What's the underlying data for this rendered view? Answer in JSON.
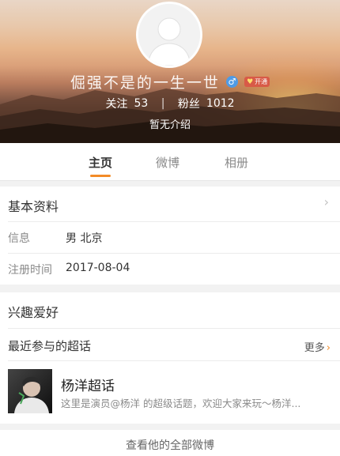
{
  "profile": {
    "username": "倔强不是的一生一世",
    "gender_icon": "male-icon",
    "vip_label": "开通",
    "follow_label": "关注",
    "follow_count": "53",
    "fans_label": "粉丝",
    "fans_count": "1012",
    "bio": "暂无介绍"
  },
  "tabs": [
    {
      "label": "主页",
      "active": true
    },
    {
      "label": "微博",
      "active": false
    },
    {
      "label": "相册",
      "active": false
    }
  ],
  "basic_info": {
    "title": "基本资料",
    "rows": [
      {
        "label": "信息",
        "value": "男  北京"
      },
      {
        "label": "注册时间",
        "value": "2017-08-04"
      }
    ]
  },
  "interests": {
    "title": "兴趣爱好",
    "recent_supertopics_label": "最近参与的超话",
    "more_label": "更多",
    "supertopic": {
      "title": "杨洋超话",
      "desc": "这里是演员@杨洋 的超级话题，欢迎大家来玩～杨洋..."
    }
  },
  "footer": {
    "view_all_label": "查看他的全部微博"
  },
  "colors": {
    "accent": "#f38b27",
    "male_badge": "#4f9be6"
  }
}
